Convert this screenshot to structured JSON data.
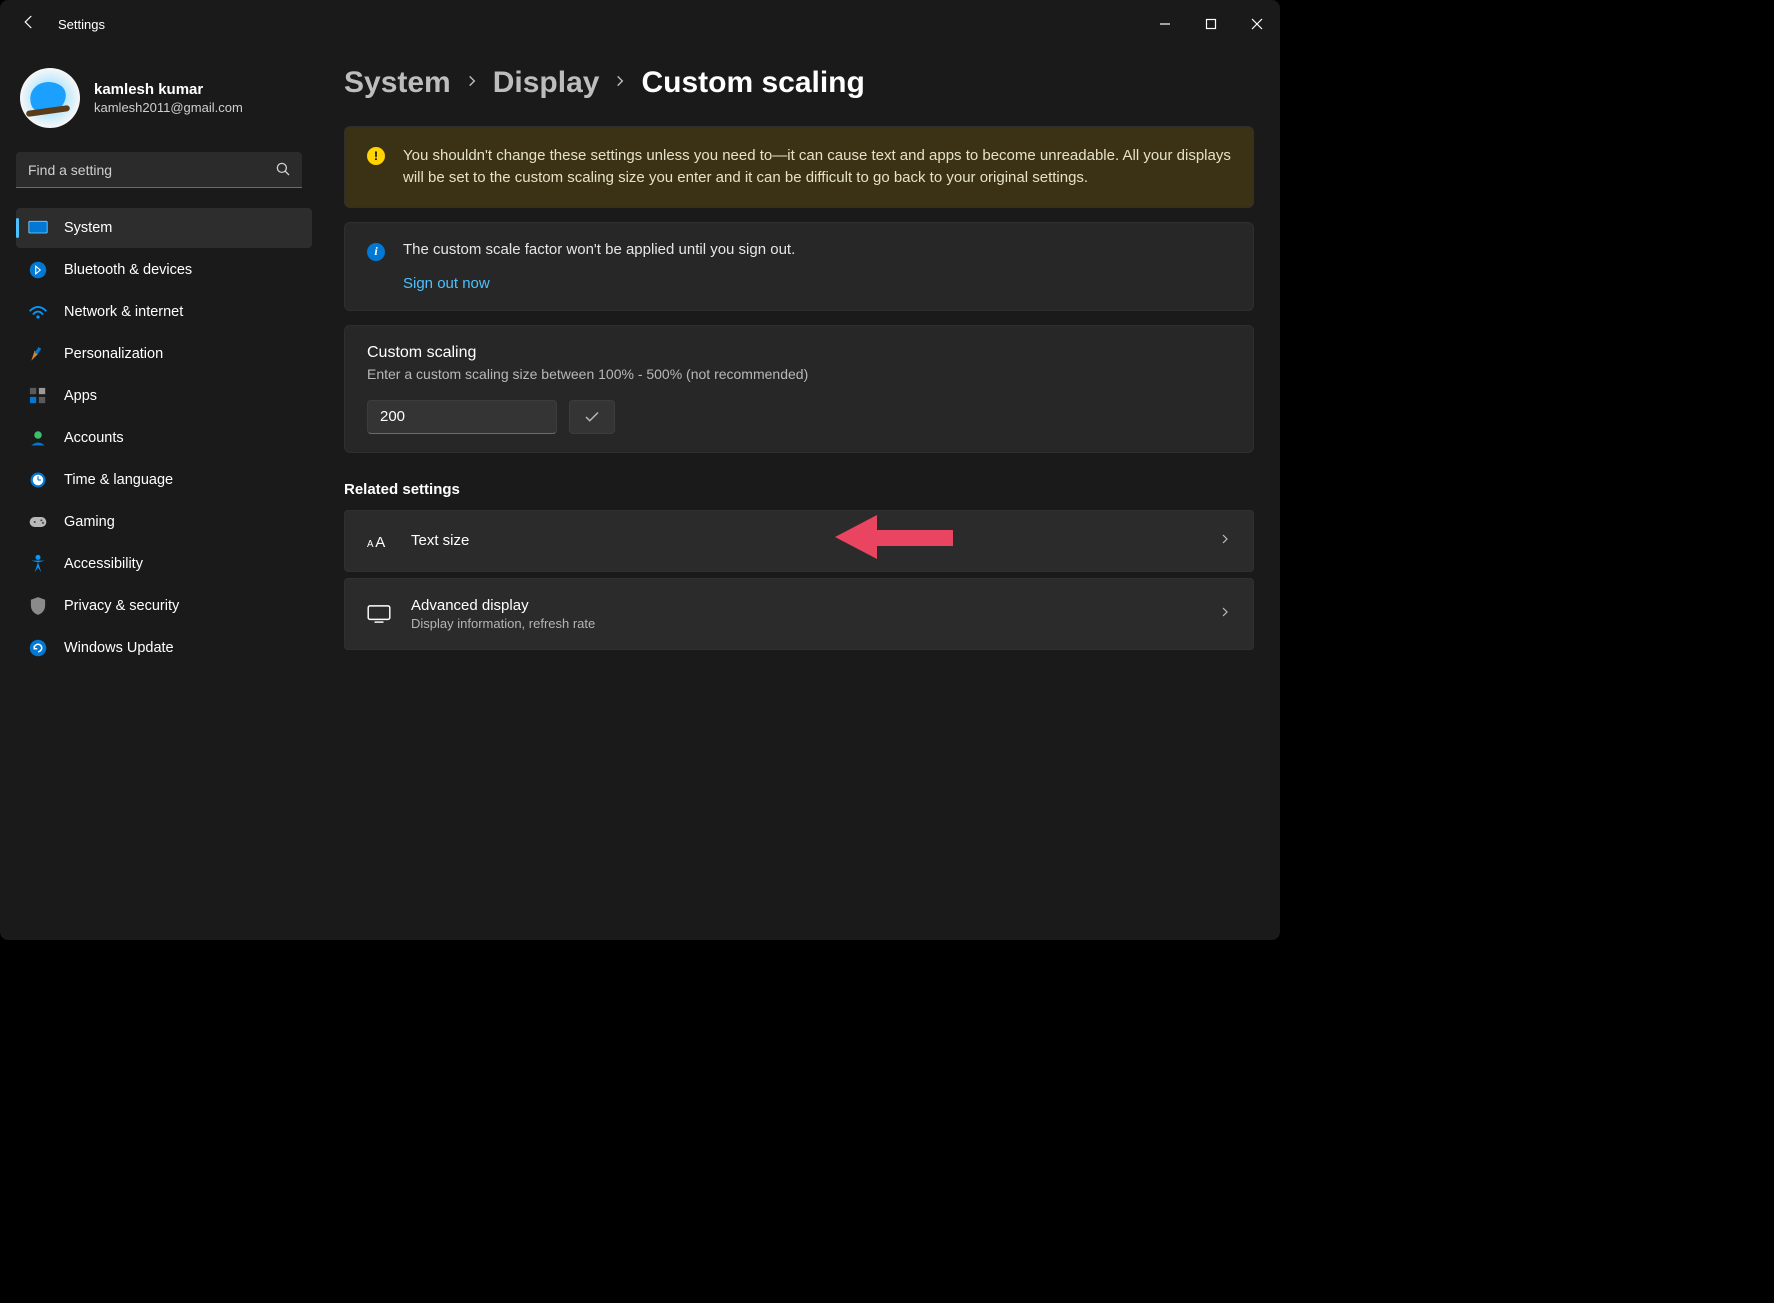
{
  "app": {
    "title": "Settings"
  },
  "profile": {
    "name": "kamlesh kumar",
    "email": "kamlesh2011@gmail.com"
  },
  "search": {
    "placeholder": "Find a setting"
  },
  "nav": [
    {
      "label": "System",
      "icon": "system"
    },
    {
      "label": "Bluetooth & devices",
      "icon": "bluetooth"
    },
    {
      "label": "Network & internet",
      "icon": "network"
    },
    {
      "label": "Personalization",
      "icon": "personalization"
    },
    {
      "label": "Apps",
      "icon": "apps"
    },
    {
      "label": "Accounts",
      "icon": "accounts"
    },
    {
      "label": "Time & language",
      "icon": "time"
    },
    {
      "label": "Gaming",
      "icon": "gaming"
    },
    {
      "label": "Accessibility",
      "icon": "accessibility"
    },
    {
      "label": "Privacy & security",
      "icon": "privacy"
    },
    {
      "label": "Windows Update",
      "icon": "update"
    }
  ],
  "breadcrumb": {
    "root": "System",
    "mid": "Display",
    "current": "Custom scaling"
  },
  "warning": {
    "text": "You shouldn't change these settings unless you need to—it can cause text and apps to become unreadable. All your displays will be set to the custom scaling size you enter and it can be difficult to go back to your original settings."
  },
  "info": {
    "text": "The custom scale factor won't be applied until you sign out.",
    "link": "Sign out now"
  },
  "custom": {
    "title": "Custom scaling",
    "sub": "Enter a custom scaling size between 100% - 500% (not recommended)",
    "value": "200"
  },
  "related": {
    "heading": "Related settings",
    "items": [
      {
        "title": "Text size",
        "sub": ""
      },
      {
        "title": "Advanced display",
        "sub": "Display information, refresh rate"
      }
    ]
  }
}
